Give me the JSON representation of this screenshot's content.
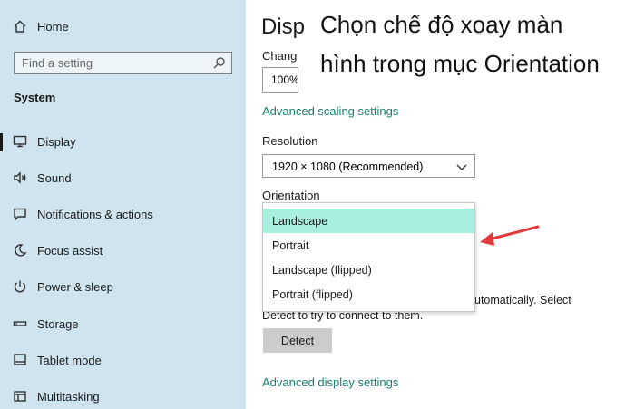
{
  "sidebar": {
    "home_label": "Home",
    "search_placeholder": "Find a setting",
    "section_title": "System",
    "items": [
      {
        "label": "Display",
        "icon": "monitor-icon",
        "active": true
      },
      {
        "label": "Sound",
        "icon": "speaker-icon"
      },
      {
        "label": "Notifications & actions",
        "icon": "message-icon"
      },
      {
        "label": "Focus assist",
        "icon": "moon-icon"
      },
      {
        "label": "Power & sleep",
        "icon": "power-icon"
      },
      {
        "label": "Storage",
        "icon": "storage-icon"
      },
      {
        "label": "Tablet mode",
        "icon": "tablet-icon"
      },
      {
        "label": "Multitasking",
        "icon": "multitasking-icon"
      }
    ]
  },
  "main": {
    "title": "Disp",
    "overlay_line1": "Chọn chế độ xoay màn",
    "overlay_line2": "hình trong mục Orientation",
    "change_label": "Chang",
    "scale_value": "100%",
    "advanced_scaling_link": "Advanced scaling settings",
    "resolution_label": "Resolution",
    "resolution_value": "1920 × 1080 (Recommended)",
    "orientation_label": "Orientation",
    "orientation_options": [
      "Landscape",
      "Portrait",
      "Landscape (flipped)",
      "Portrait (flipped)"
    ],
    "orientation_selected": "Landscape",
    "detect_text_line1": "utomatically. Select",
    "detect_text_line2": "Detect to try to connect to them.",
    "detect_button": "Detect",
    "advanced_display_link": "Advanced display settings"
  },
  "colors": {
    "sidebar_bg": "#cfe4ef",
    "link": "#18806f",
    "selected_option": "#a8efe0",
    "arrow": "#e03a3a"
  }
}
